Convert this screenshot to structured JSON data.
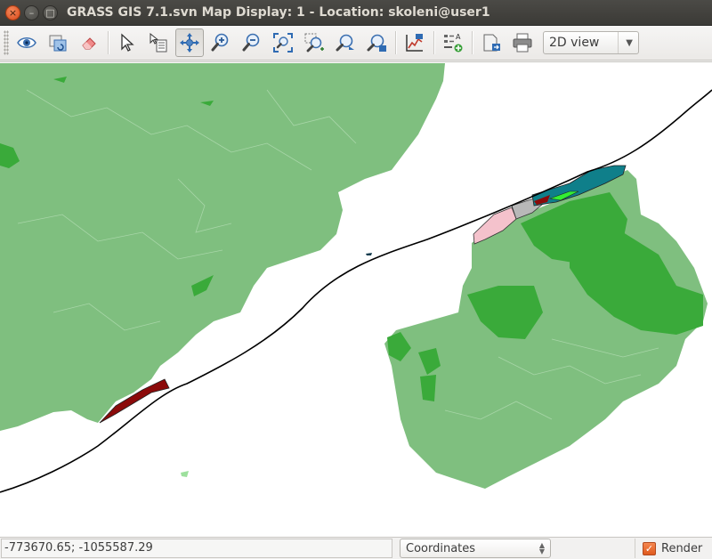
{
  "window": {
    "title": "GRASS GIS 7.1.svn Map Display: 1  - Location: skoleni@user1",
    "buttons": {
      "close": "×",
      "minimize": "–",
      "maximize": "□"
    }
  },
  "toolbar": {
    "tools": [
      {
        "name": "display-map-icon"
      },
      {
        "name": "render-map-icon"
      },
      {
        "name": "erase-display-icon"
      },
      {
        "name": "pointer-icon"
      },
      {
        "name": "query-icon"
      },
      {
        "name": "pan-icon",
        "active": true
      },
      {
        "name": "zoom-in-icon"
      },
      {
        "name": "zoom-out-icon"
      },
      {
        "name": "zoom-extent-icon"
      },
      {
        "name": "zoom-region-icon"
      },
      {
        "name": "zoom-back-icon"
      },
      {
        "name": "zoom-menu-icon"
      },
      {
        "name": "analyze-icon"
      },
      {
        "name": "overlay-icon"
      },
      {
        "name": "save-image-icon"
      },
      {
        "name": "print-icon"
      }
    ],
    "view_mode": "2D view"
  },
  "statusbar": {
    "coordinates": "-773670.65; -1055587.29",
    "mode": "Coordinates",
    "render_label": "Render",
    "render_checked": true
  },
  "colors": {
    "land": "#7fbf7f",
    "forest": "#3aaa3a",
    "water": "#ffffff",
    "accent": "#dd5a1f"
  }
}
